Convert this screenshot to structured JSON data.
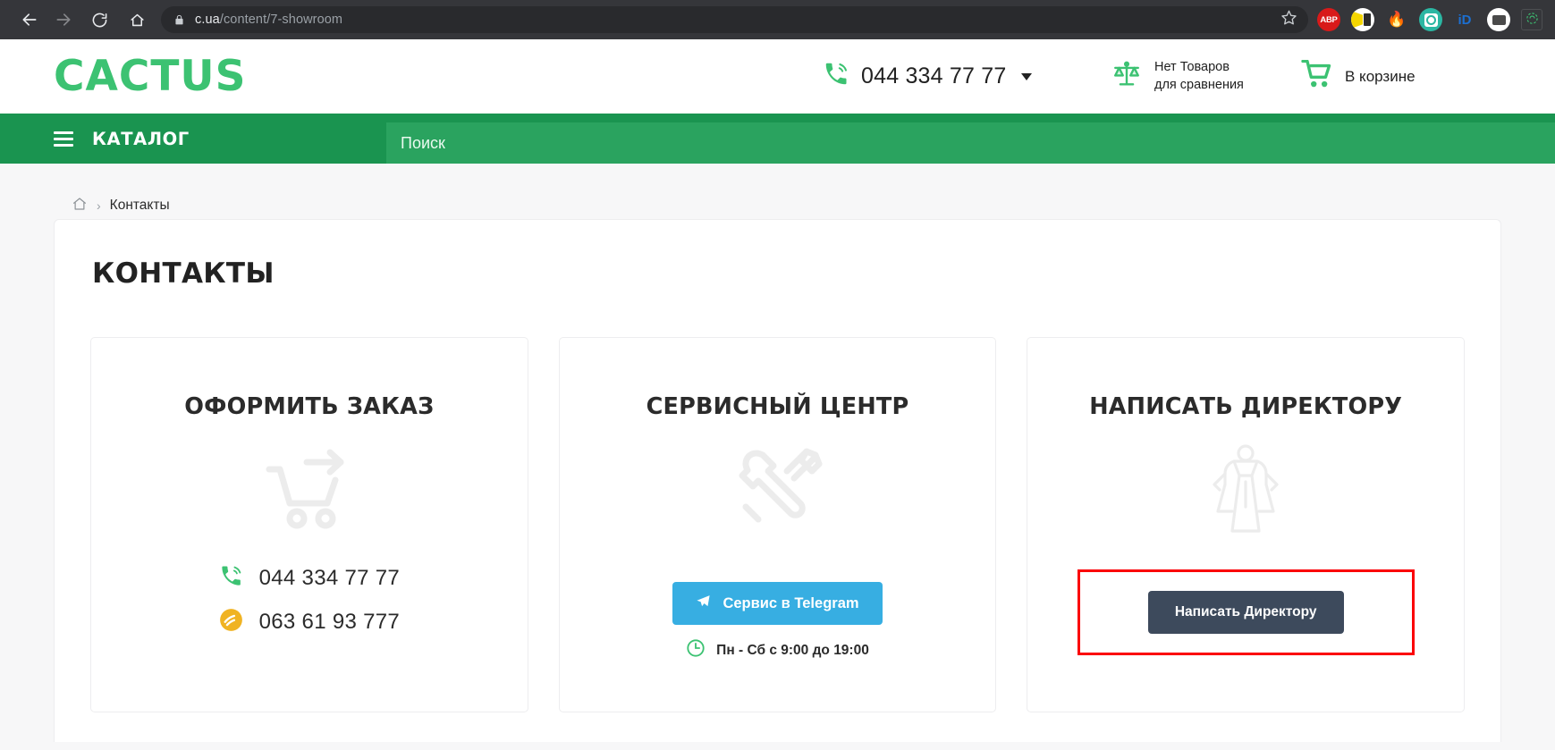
{
  "browser": {
    "back_icon": "arrow-left-icon",
    "forward_icon": "arrow-right-icon",
    "reload_icon": "reload-icon",
    "home_icon": "home-icon",
    "lock_icon": "lock-icon",
    "url_host": "c.ua",
    "url_path": "/content/7-showroom",
    "bookmark_icon": "star-icon",
    "extensions": [
      {
        "name": "adblock-plus-extension",
        "label": "ABP"
      },
      {
        "name": "lastpass-extension",
        "label": ""
      },
      {
        "name": "fire-extension",
        "label": "🔥"
      },
      {
        "name": "teal-extension",
        "label": ""
      },
      {
        "name": "identity-extension",
        "label": "iD"
      },
      {
        "name": "card-extension",
        "label": ""
      },
      {
        "name": "recorder-extension",
        "label": ""
      }
    ]
  },
  "header": {
    "logo_text": "CACTUS",
    "phone": "044 334 77 77",
    "phone_icon": "phone-icon",
    "phone_dropdown_icon": "chevron-down-icon",
    "compare_icon": "scales-icon",
    "compare_label": "Нет Товаров для сравнения",
    "cart_icon": "cart-icon",
    "cart_label": "В корзине"
  },
  "nav": {
    "menu_icon": "hamburger-icon",
    "catalog_label": "КАТАЛОГ",
    "search_placeholder": "Поиск"
  },
  "breadcrumb": {
    "home_icon": "home-icon",
    "separator": "›",
    "current": "Контакты"
  },
  "main": {
    "page_title": "КОНТАКТЫ",
    "cards": [
      {
        "title": "ОФОРМИТЬ ЗАКАЗ",
        "art_icon": "shopping-cart-arrow-icon",
        "phones": [
          {
            "icon": "phone-green-icon",
            "number": "044 334 77 77"
          },
          {
            "icon": "viber-icon",
            "number": "063 61 93 777"
          }
        ]
      },
      {
        "title": "СЕРВИСНЫЙ ЦЕНТР",
        "art_icon": "wrench-screwdriver-icon",
        "telegram_icon": "telegram-icon",
        "telegram_label": "Сервис в Telegram",
        "hours_icon": "clock-icon",
        "hours_label": "Пн - Сб с 9:00 до 19:00"
      },
      {
        "title": "НАПИСАТЬ ДИРЕКТОРУ",
        "art_icon": "superhero-icon",
        "button_label": "Написать Директору",
        "highlight_color": "#fb0007"
      }
    ]
  },
  "colors": {
    "brand_green": "#3cc272",
    "nav_green": "#1a9450",
    "search_green": "#2aa35f",
    "telegram_blue": "#37aee2",
    "director_btn": "#3d4a5c",
    "highlight_red": "#fb0007",
    "viber_yellow": "#f0b323"
  }
}
